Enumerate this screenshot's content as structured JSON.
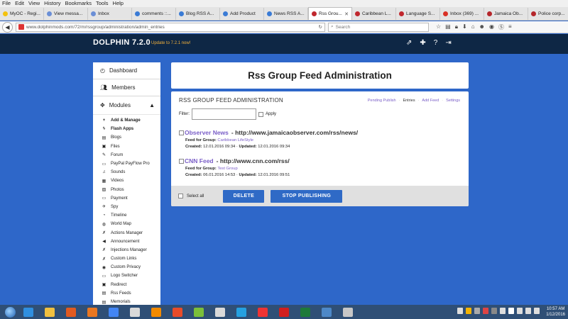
{
  "browser": {
    "menu": [
      "File",
      "Edit",
      "View",
      "History",
      "Bookmarks",
      "Tools",
      "Help"
    ],
    "tabs": [
      {
        "label": "MyOC - Regi...",
        "color": "#f4c20d"
      },
      {
        "label": "View messa...",
        "color": "#6b8fd6"
      },
      {
        "label": "Inbox",
        "color": "#6b8fd6"
      },
      {
        "label": "comments ::...",
        "color": "#3a7bd5"
      },
      {
        "label": "Blog RSS A...",
        "color": "#3a7bd5"
      },
      {
        "label": "Add Product",
        "color": "#3a7bd5"
      },
      {
        "label": "News RSS A...",
        "color": "#3a7bd5"
      },
      {
        "label": "Rss Grou...",
        "color": "#c0272d",
        "active": true
      },
      {
        "label": "Caribbean L...",
        "color": "#c0272d"
      },
      {
        "label": "Language S...",
        "color": "#c0272d"
      },
      {
        "label": "Inbox (369) ...",
        "color": "#d93025"
      },
      {
        "label": "Jamaica Ob...",
        "color": "#b5262b"
      },
      {
        "label": "Police corp...",
        "color": "#b5262b"
      }
    ],
    "url": "www.dolphinmods.com/72/m/rssgroup/administration/admin_entries",
    "search_placeholder": "Search"
  },
  "app": {
    "brand": "DOLPHIN 7.2.0",
    "update": "Update to 7.2.1 now!"
  },
  "sidebar": {
    "dashboard": "Dashboard",
    "members": "Members",
    "modules": "Modules",
    "items": [
      {
        "label": "Add & Manage",
        "icon": "+",
        "bold": true
      },
      {
        "label": "Flash Apps",
        "icon": "ϟ",
        "bold": true
      },
      {
        "label": "Blogs",
        "icon": "▤"
      },
      {
        "label": "Files",
        "icon": "▣"
      },
      {
        "label": "Forum",
        "icon": "✎"
      },
      {
        "label": "PayPal PayFlow Pro",
        "icon": "▭"
      },
      {
        "label": "Sounds",
        "icon": "♫"
      },
      {
        "label": "Videos",
        "icon": "▦"
      },
      {
        "label": "Photos",
        "icon": "▨"
      },
      {
        "label": "Payment",
        "icon": "▭"
      },
      {
        "label": "Spy",
        "icon": "✈"
      },
      {
        "label": "Timeline",
        "icon": "◔"
      },
      {
        "label": "World Map",
        "icon": "◍"
      },
      {
        "label": "Actions Manager",
        "icon": "✗"
      },
      {
        "label": "Announcement",
        "icon": "◀"
      },
      {
        "label": "Injections Manager",
        "icon": "✗"
      },
      {
        "label": "Custom Links",
        "icon": "✗"
      },
      {
        "label": "Custom Privacy",
        "icon": "◉"
      },
      {
        "label": "Logo Switcher",
        "icon": "▭"
      },
      {
        "label": "Redirect",
        "icon": "▣"
      },
      {
        "label": "Rss Feeds",
        "icon": "▤"
      },
      {
        "label": "Memorials",
        "icon": "▤"
      }
    ]
  },
  "page": {
    "title": "Rss Group Feed Administration",
    "panel_title": "RSS GROUP FEED ADMINISTRATION",
    "links": {
      "pending": "Pending Publish",
      "entries": "Entries",
      "add": "Add Feed",
      "settings": "Settings"
    },
    "filter_label": "Filter:",
    "apply_label": "Apply",
    "feeds": [
      {
        "name": "Observer News",
        "url": "- http://www.jamaicaobserver.com/rss/news/",
        "group_label": "Feed for Group:",
        "group": "Caribbean LifeStyle",
        "created_label": "Created:",
        "created": "12.01.2016 09:34",
        "updated_label": "Updated:",
        "updated": "12.01.2016 09:34"
      },
      {
        "name": "CNN Feed",
        "url": "- http://www.cnn.com/rss/",
        "group_label": "Feed for Group:",
        "group": "Test Group",
        "created_label": "Created:",
        "created": "06.01.2016 14:53",
        "updated_label": "Updated:",
        "updated": "12.01.2016 09:51"
      }
    ],
    "select_all": "Select all",
    "delete": "DELETE",
    "stop": "STOP PUBLISHING"
  },
  "taskbar": {
    "time": "10:57 AM",
    "date": "1/12/2016",
    "apps": [
      "#2f8fe0",
      "#f0c040",
      "#e05a20",
      "#e87722",
      "#4285f4",
      "#d9d9d9",
      "#f28a00",
      "#e84c2a",
      "#7bbf3a",
      "#d9d9d9",
      "#25a0e0",
      "#e33",
      "#d01e1e",
      "#1d7a3a",
      "#4d88c8",
      "#c7c7c7"
    ],
    "tray": [
      "#ddd",
      "#f5b400",
      "#aaa",
      "#d44",
      "#888",
      "#ddd",
      "#fff",
      "#ddd",
      "#ddd",
      "#ddd"
    ]
  }
}
